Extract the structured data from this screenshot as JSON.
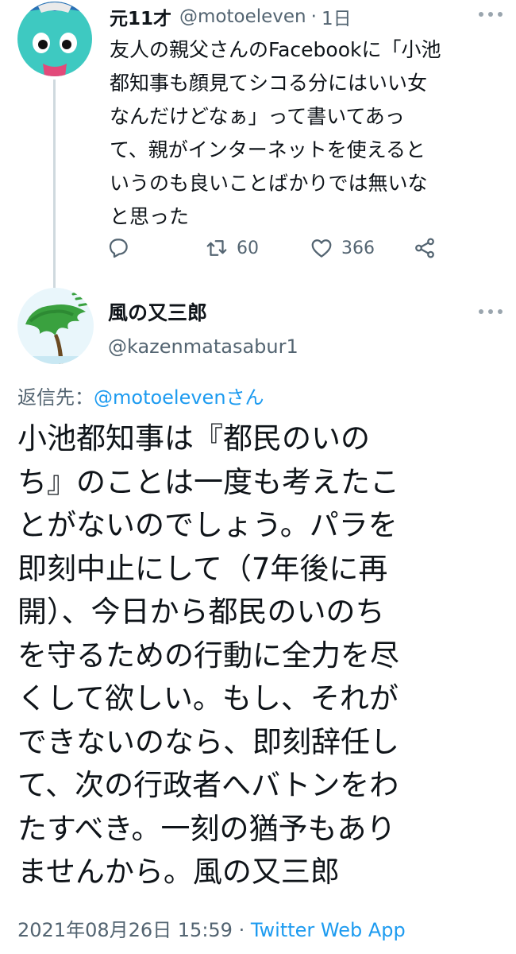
{
  "parent_tweet": {
    "display_name": "元11才",
    "handle": "@motoeleven",
    "separator": "·",
    "time_ago": "1日",
    "text_lines": [
      "友人の親父さんのFacebookに「小池",
      "都知事も顔見てシコる分にはいい女",
      "なんだけどなぁ」って書いてあっ",
      "て、親がインターネットを使えると",
      "いうのも良いことばかりでは無いな",
      "と思った"
    ],
    "retweet_count": "60",
    "like_count": "366"
  },
  "main_tweet": {
    "display_name": "風の又三郎",
    "handle": "@kazenmatasabur1",
    "reply_prefix": "返信先：",
    "reply_mention": "@motoelevenさん",
    "text_lines": [
      "小池都知事は『都民のいの",
      "ち』のことは一度も考えたこ",
      "とがないのでしょう。パラを",
      "即刻中止にして（7年後に再",
      "開）、今日から都民のいのち",
      "を守るための行動に全力を尽",
      "くして欲しい。もし、それが",
      "できないのなら、即刻辞任し",
      "て、次の行政者へバトンをわ",
      "たすべき。一刻の猶予もあり",
      "ませんから。風の又三郎"
    ],
    "timestamp": "2021年08月26日 15:59",
    "separator": " · ",
    "source": "Twitter Web App"
  },
  "icons": {
    "reply": "reply-icon",
    "retweet": "retweet-icon",
    "like": "heart-icon",
    "share": "share-icon",
    "more": "more-icon"
  },
  "colors": {
    "text": "#0f1419",
    "secondary": "#536471",
    "link": "#1d9bf0",
    "thread_line": "#cfd9de"
  }
}
